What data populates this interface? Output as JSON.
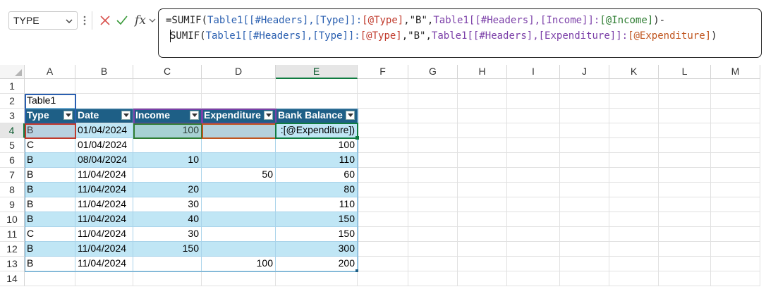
{
  "name_box": {
    "value": "TYPE"
  },
  "formula_bar": {
    "fx_label": "fx",
    "line1": [
      {
        "t": "=SUMIF(",
        "c": "c-dark"
      },
      {
        "t": "Table1[[#Headers],[Type]]:",
        "c": "c-blue"
      },
      {
        "t": "[@Type]",
        "c": "c-red"
      },
      {
        "t": ",\"B\",",
        "c": "c-dark"
      },
      {
        "t": "Table1[[#Headers],[Income]]:",
        "c": "c-purple"
      },
      {
        "t": "[@Income]",
        "c": "c-green"
      },
      {
        "t": ")-",
        "c": "c-dark"
      }
    ],
    "line2": [
      {
        "t": "SUMIF(",
        "c": "c-dark"
      },
      {
        "t": "Table1[[#Headers],[Type]]:",
        "c": "c-blue"
      },
      {
        "t": "[@Type]",
        "c": "c-red"
      },
      {
        "t": ",\"B\",",
        "c": "c-dark"
      },
      {
        "t": "Table1[[#Headers],[Expenditure]]:",
        "c": "c-purple"
      },
      {
        "t": "[@Expenditure]",
        "c": "c-orange"
      },
      {
        "t": ")",
        "c": "c-dark"
      }
    ]
  },
  "columns": [
    "A",
    "B",
    "C",
    "D",
    "E",
    "F",
    "G",
    "H",
    "I",
    "J",
    "K",
    "L",
    "M"
  ],
  "selected_column": "E",
  "rows": [
    "1",
    "2",
    "3",
    "4",
    "5",
    "6",
    "7",
    "8",
    "9",
    "10",
    "11",
    "12",
    "13",
    "14"
  ],
  "selected_row": "4",
  "table_name_cell": "Table1",
  "table": {
    "headers": [
      "Type",
      "Date",
      "Income",
      "Expenditure",
      "Bank Balance"
    ],
    "rows": [
      [
        "B",
        "01/04/2024",
        "100",
        "",
        ":[@Expenditure])"
      ],
      [
        "C",
        "01/04/2024",
        "",
        "",
        "100"
      ],
      [
        "B",
        "08/04/2024",
        "10",
        "",
        "110"
      ],
      [
        "B",
        "11/04/2024",
        "",
        "50",
        "60"
      ],
      [
        "B",
        "11/04/2024",
        "20",
        "",
        "80"
      ],
      [
        "B",
        "11/04/2024",
        "30",
        "",
        "110"
      ],
      [
        "B",
        "11/04/2024",
        "40",
        "",
        "150"
      ],
      [
        "C",
        "11/04/2024",
        "30",
        "",
        "150"
      ],
      [
        "B",
        "11/04/2024",
        "150",
        "",
        "300"
      ],
      [
        "B",
        "11/04/2024",
        "",
        "100",
        "200"
      ]
    ]
  },
  "colors": {
    "header_bg": "#1e5f86",
    "band_bg": "#c0e6f5",
    "selection": "#107c41",
    "ref_type": "#c0392b",
    "ref_income": "#2e7d32",
    "ref_expenditure": "#c0551e",
    "ref_header_type": "#2a5fb0",
    "ref_header_other": "#7b3fa8"
  }
}
